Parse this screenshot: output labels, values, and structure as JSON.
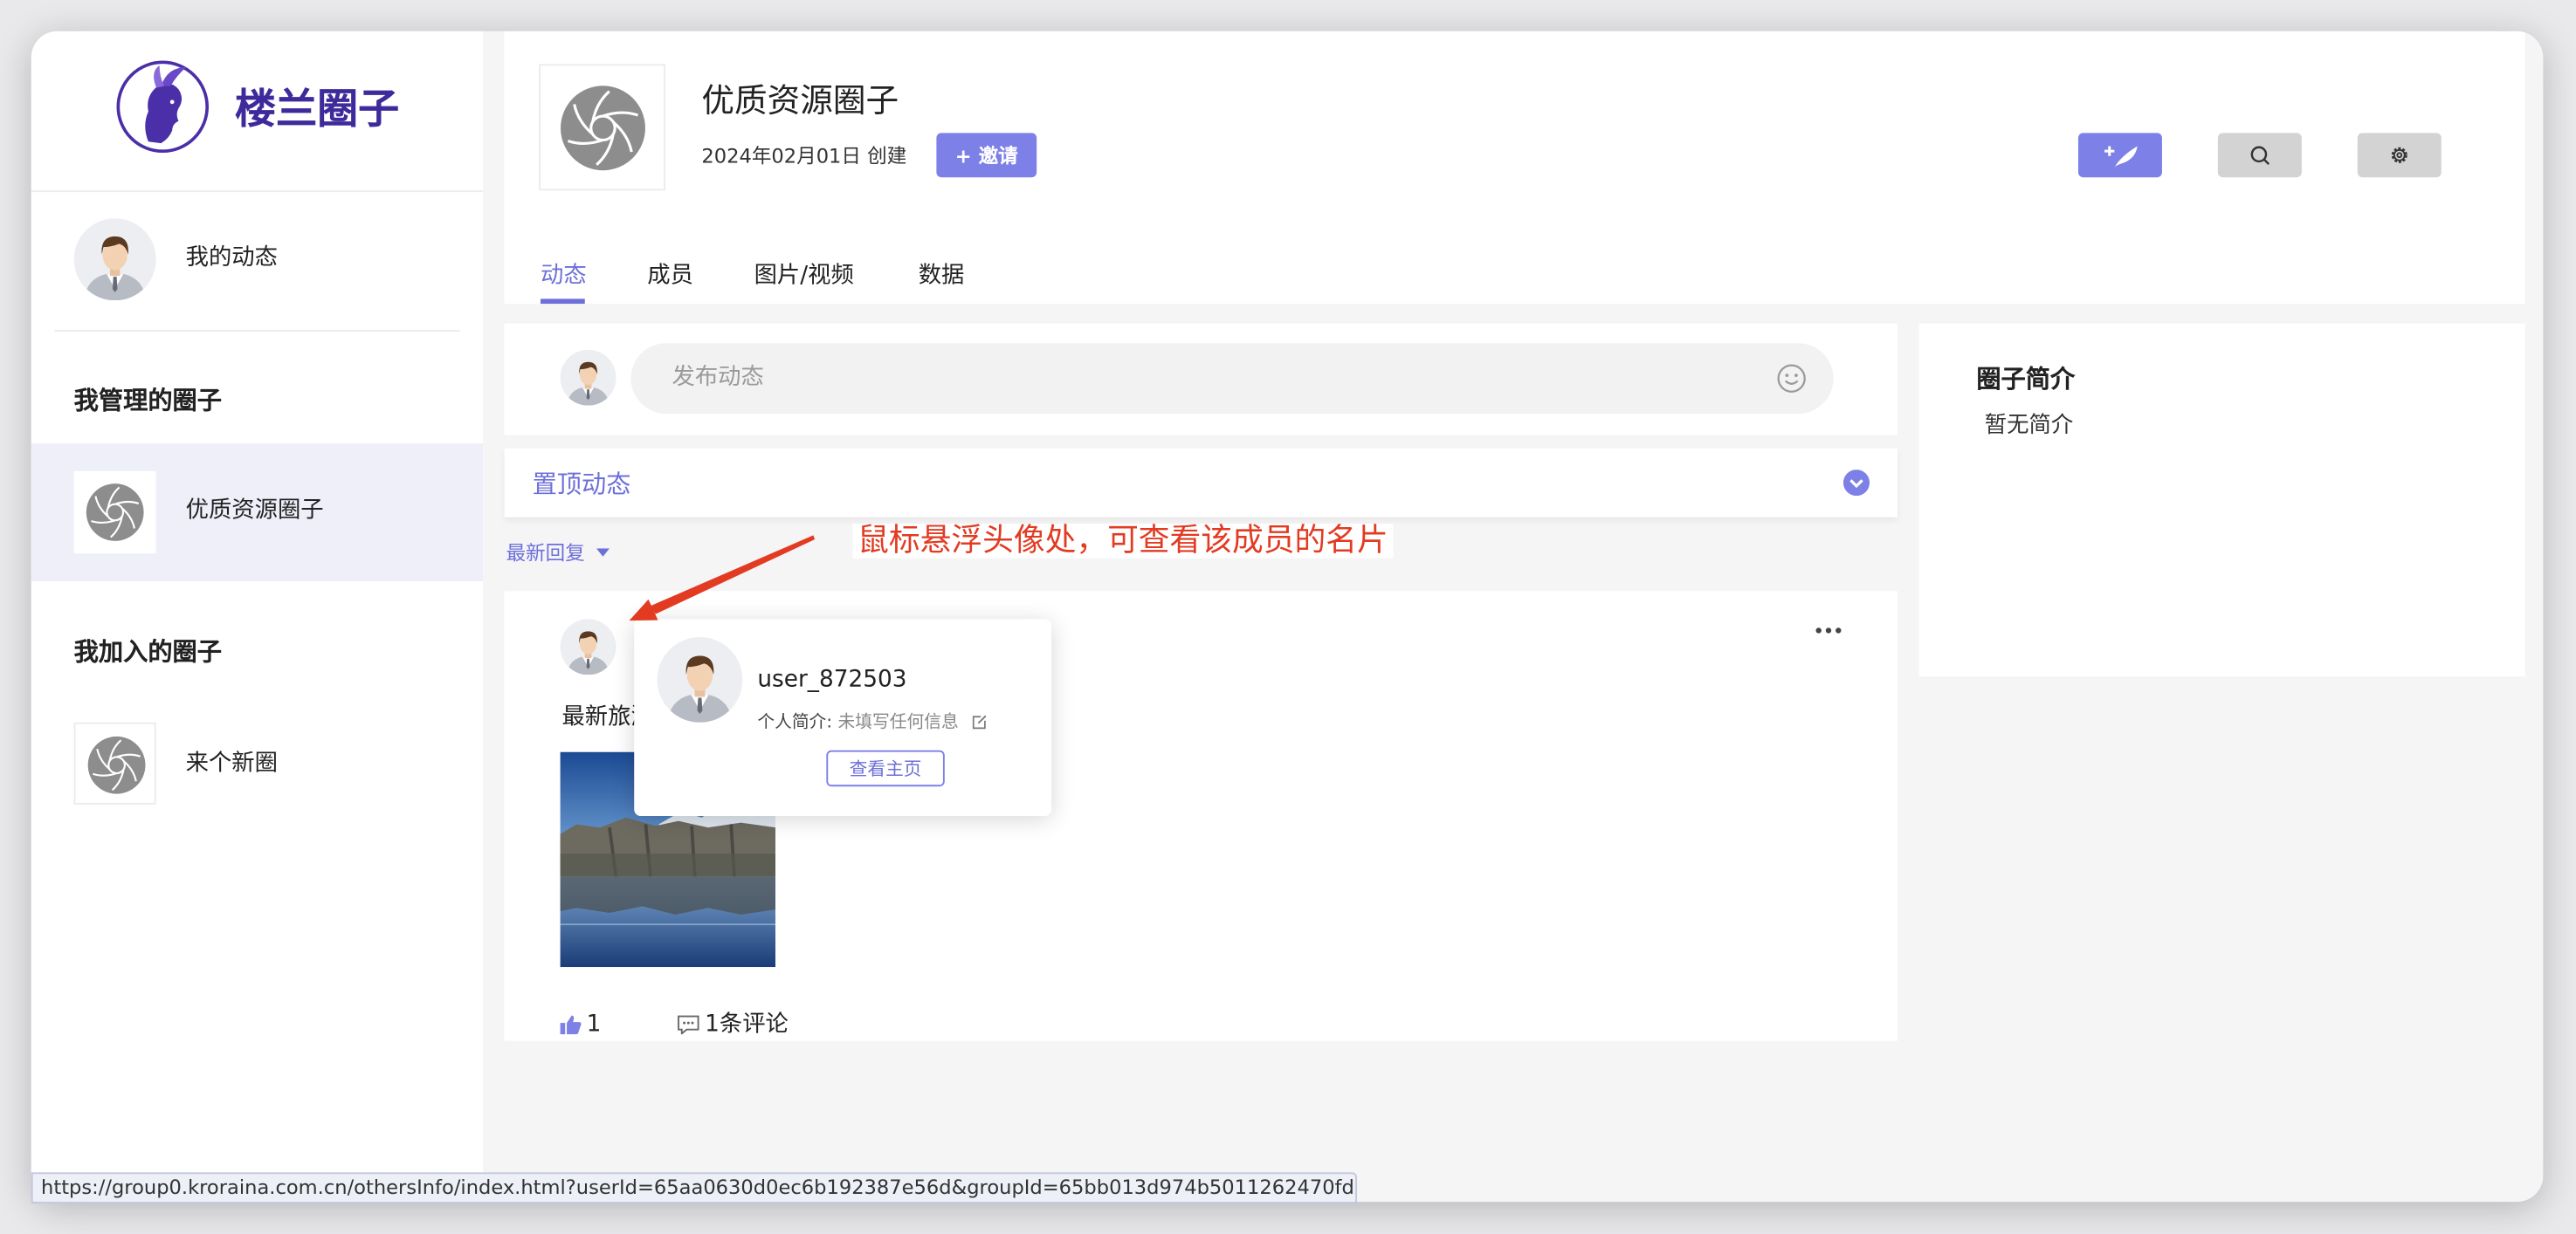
{
  "app": {
    "logo_text": "楼兰圈子",
    "logo_icon": "logo-icon"
  },
  "sidebar": {
    "my_feed": "我的动态",
    "managed_heading": "我管理的圈子",
    "managed": [
      {
        "name": "优质资源圈子",
        "selected": true
      }
    ],
    "joined_heading": "我加入的圈子",
    "joined": [
      {
        "name": "来个新圈"
      }
    ]
  },
  "group": {
    "name": "优质资源圈子",
    "created": "2024年02月01日 创建",
    "invite_label": "+ 邀请",
    "icon": "aperture-icon"
  },
  "toolbar": {
    "post_icon": "feather-plus-icon",
    "search_icon": "search-icon",
    "settings_icon": "gear-icon"
  },
  "tabs": [
    {
      "label": "动态",
      "active": true
    },
    {
      "label": "成员"
    },
    {
      "label": "图片/视频"
    },
    {
      "label": "数据"
    }
  ],
  "composer": {
    "placeholder": "发布动态",
    "emoji_icon": "smiley-icon"
  },
  "pinned": {
    "label": "置顶动态",
    "toggle_icon": "chevron-down-circle-icon"
  },
  "sort": {
    "label": "最新回复"
  },
  "annotation": {
    "text": "鼠标悬浮头像处，可查看该成员的名片"
  },
  "post": {
    "text": "最新旅游",
    "image": "landscape-photo",
    "likes": "1",
    "comments": "1条评论"
  },
  "profile_card": {
    "username": "user_872503",
    "bio_label": "个人简介:",
    "bio": "未填写任何信息",
    "view_button": "查看主页"
  },
  "about": {
    "heading": "圈子简介",
    "text": "暂无简介"
  },
  "status_bar": {
    "url": "https://group0.kroraina.com.cn/othersInfo/index.html?userId=65aa0630d0ec6b192387e56d&groupId=65bb013d974b5011262470fd"
  },
  "colors": {
    "accent": "#7d80e6",
    "logo": "#3f2a9c",
    "annotation": "#e23b22",
    "selected_bg": "#efeff9"
  }
}
